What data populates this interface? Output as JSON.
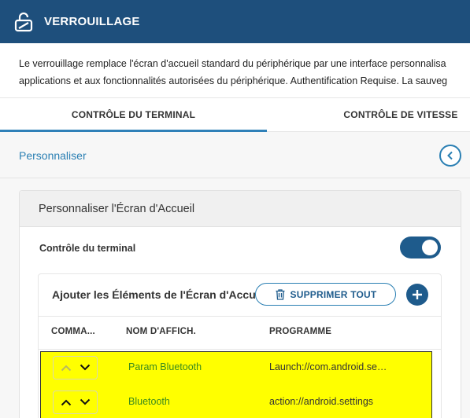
{
  "header": {
    "title": "VERROUILLAGE",
    "icon": "unlock-icon"
  },
  "description": {
    "line1": "Le verrouillage remplace l'écran d'accueil standard du périphérique par une interface personnalisa",
    "line2": "applications et aux fonctionnalités autorisées du périphérique. Authentification Requise. La sauveg"
  },
  "tabs": [
    {
      "label": "CONTRÔLE DU TERMINAL",
      "active": true
    },
    {
      "label": "CONTRÔLE DE VITESSE",
      "active": false
    }
  ],
  "breadcrumb": {
    "label": "Personnaliser",
    "back_icon": "chevron-left-icon"
  },
  "panel": {
    "title": "Personnaliser l'Écran d'Accueil",
    "toggle_label": "Contrôle du terminal",
    "toggle_on": true
  },
  "card": {
    "title": "Ajouter les Éléments de l'Écran d'Accueil",
    "delete_all_label": "SUPPRIMER TOUT",
    "delete_icon": "trash-icon",
    "add_icon": "plus-icon"
  },
  "table": {
    "columns": [
      "COMMA...",
      "NOM D'AFFICH.",
      "PROGRAMME"
    ],
    "rows": [
      {
        "display_name": "Param Bluetooth",
        "program": "Launch://com.android.settings"
      },
      {
        "display_name": "Bluetooth",
        "program": "action://android.settings"
      }
    ]
  },
  "colors": {
    "header_bg": "#1e4f7c",
    "accent": "#2a7fb3",
    "highlight": "#ffff00",
    "name_text": "#3a8a1e"
  }
}
